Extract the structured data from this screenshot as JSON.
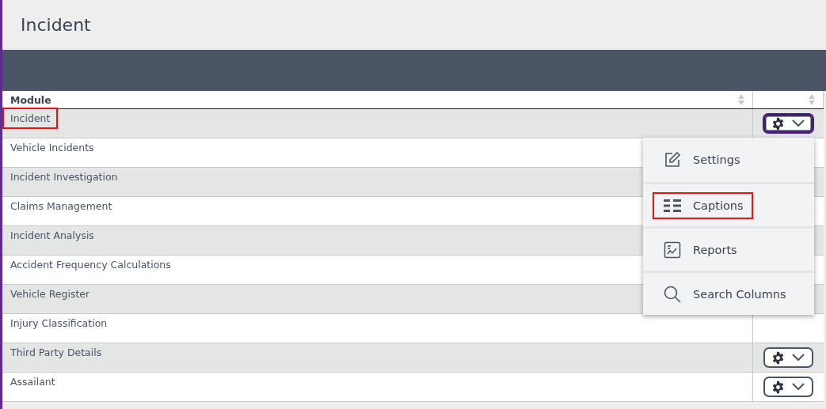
{
  "page_title": "Incident",
  "table": {
    "columns": [
      "Module"
    ],
    "rows": [
      {
        "module": "Incident",
        "highlighted": true
      },
      {
        "module": "Vehicle Incidents",
        "highlighted": false
      },
      {
        "module": "Incident Investigation",
        "highlighted": false
      },
      {
        "module": "Claims Management",
        "highlighted": false
      },
      {
        "module": "Incident Analysis",
        "highlighted": false
      },
      {
        "module": "Accident Frequency Calculations",
        "highlighted": false
      },
      {
        "module": "Vehicle Register",
        "highlighted": false
      },
      {
        "module": "Injury Classification",
        "highlighted": false
      },
      {
        "module": "Third Party Details",
        "highlighted": false
      },
      {
        "module": "Assailant",
        "highlighted": false
      }
    ]
  },
  "menu": {
    "trigger_focused": true,
    "items": [
      {
        "label": "Settings",
        "kind": "edit",
        "highlighted": false
      },
      {
        "label": "Captions",
        "kind": "list",
        "highlighted": true
      },
      {
        "label": "Reports",
        "kind": "report",
        "highlighted": false
      },
      {
        "label": "Search Columns",
        "kind": "search",
        "highlighted": false
      }
    ]
  }
}
